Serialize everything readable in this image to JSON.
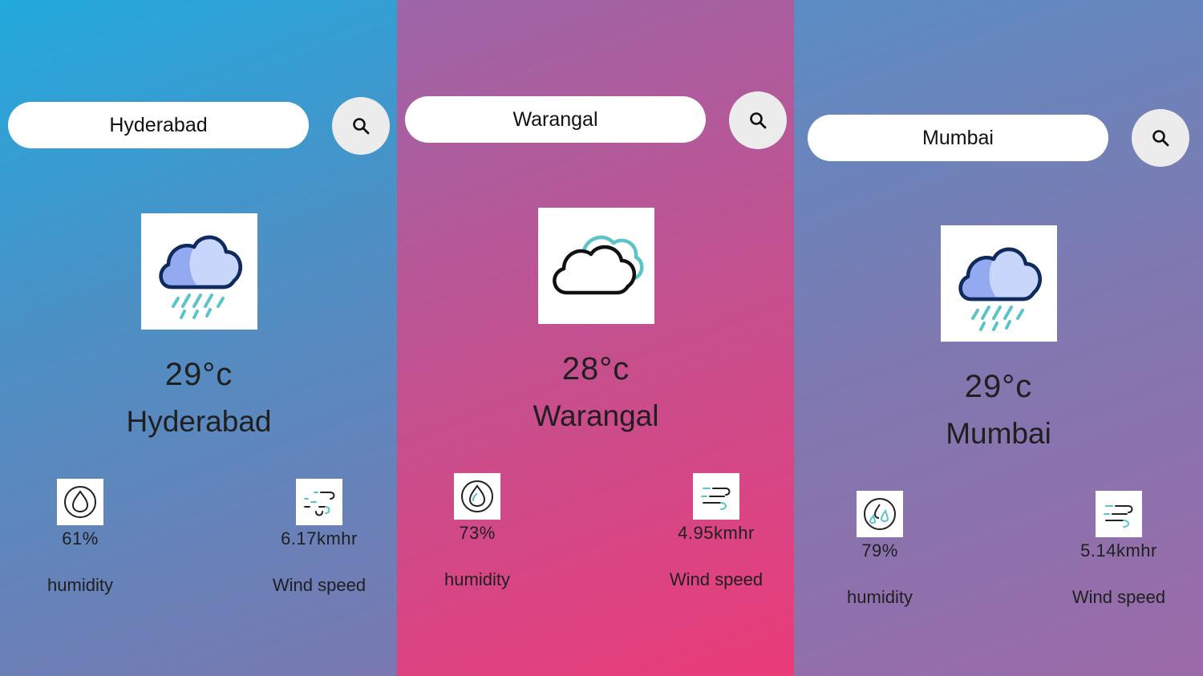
{
  "panels": [
    {
      "search_value": "Hyderabad",
      "temperature": "29°c",
      "city": "Hyderabad",
      "condition_icon": "rain-cloud-icon",
      "humidity_value": "61%",
      "humidity_label": "humidity",
      "wind_value": "6.17kmhr",
      "wind_label": "Wind speed"
    },
    {
      "search_value": "Warangal",
      "temperature": "28°c",
      "city": "Warangal",
      "condition_icon": "cloud-icon",
      "humidity_value": "73%",
      "humidity_label": "humidity",
      "wind_value": "4.95kmhr",
      "wind_label": "Wind speed"
    },
    {
      "search_value": "Mumbai",
      "temperature": "29°c",
      "city": "Mumbai",
      "condition_icon": "rain-cloud-icon",
      "humidity_value": "79%",
      "humidity_label": "humidity",
      "wind_value": "5.14kmhr",
      "wind_label": "Wind speed"
    }
  ],
  "icons": {
    "search": "search-icon",
    "humidity": "humidity-icon",
    "wind": "wind-icon"
  },
  "colors": {
    "panel1_start": "#22a9dd",
    "panel2_end": "#ea3c79",
    "panel3_start": "#5a8dc4",
    "cloud_fill": "#c9d6fb",
    "cloud_outline": "#0f2a5c",
    "rain": "#5cc4c8"
  }
}
